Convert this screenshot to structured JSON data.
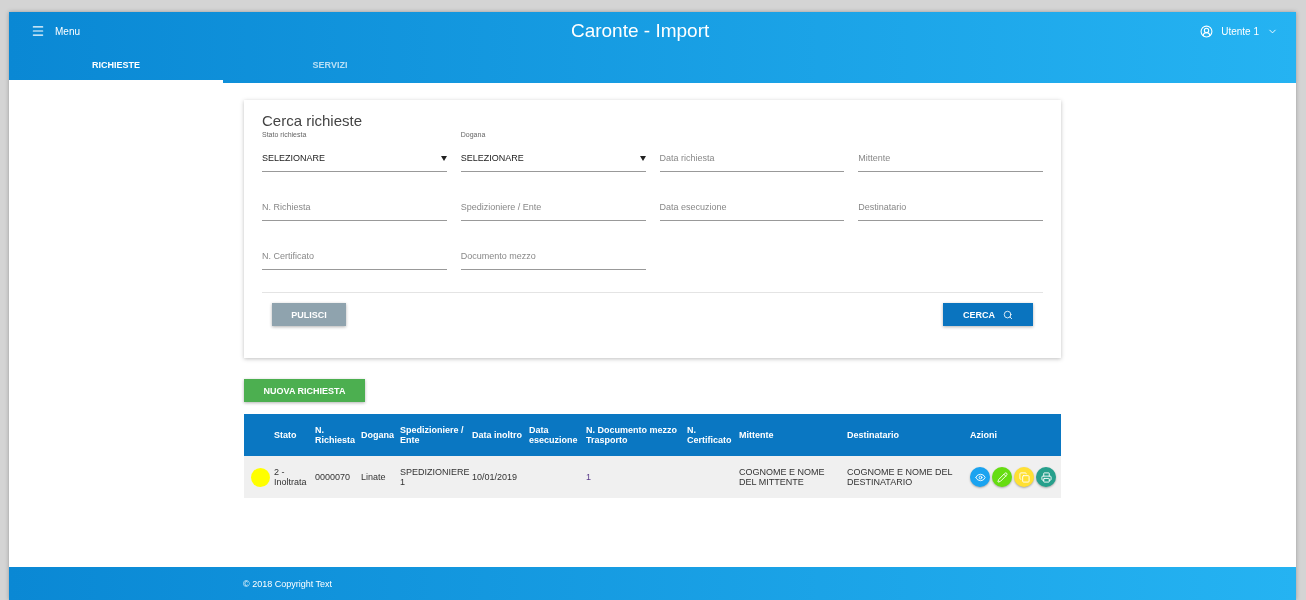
{
  "header": {
    "menu_label": "Menu",
    "title": "Caronte - Import",
    "user": "Utente 1"
  },
  "tabs": [
    {
      "label": "RICHIESTE",
      "selected": true
    },
    {
      "label": "SERVIZI",
      "selected": false
    }
  ],
  "search_card": {
    "title": "Cerca richieste",
    "fields": [
      {
        "kind": "select",
        "label": "Stato richiesta",
        "value": "SELEZIONARE"
      },
      {
        "kind": "select",
        "label": "Dogana",
        "value": "SELEZIONARE"
      },
      {
        "kind": "text",
        "placeholder": "Data richiesta"
      },
      {
        "kind": "text",
        "placeholder": "Mittente"
      },
      {
        "kind": "text",
        "placeholder": "N. Richiesta"
      },
      {
        "kind": "text",
        "placeholder": "Spedizioniere / Ente"
      },
      {
        "kind": "text",
        "placeholder": "Data esecuzione"
      },
      {
        "kind": "text",
        "placeholder": "Destinatario"
      },
      {
        "kind": "text",
        "placeholder": "N. Certificato"
      },
      {
        "kind": "text",
        "placeholder": "Documento mezzo"
      }
    ],
    "clear_button": "PULISCI",
    "search_button": "CERCA"
  },
  "new_button": "NUOVA RICHIESTA",
  "table": {
    "columns": [
      "Stato",
      "N. Richiesta",
      "Dogana",
      "Spedizioniere / Ente",
      "Data inoltro",
      "Data esecuzione",
      "N. Documento mezzo Trasporto",
      "N. Certificato",
      "Mittente",
      "Destinatario",
      "Azioni"
    ],
    "rows": [
      {
        "color": "#ffff00",
        "cells": [
          "2 - Inoltrata",
          "0000070",
          "Linate",
          "SPEDIZIONIERE 1",
          "10/01/2019",
          "",
          "1",
          "",
          "COGNOME E NOME DEL MITTENTE",
          "COGNOME E NOME DEL DESTINATARIO"
        ],
        "actions": [
          {
            "kind": "view"
          },
          {
            "kind": "edit"
          },
          {
            "kind": "copy"
          },
          {
            "kind": "print"
          }
        ]
      }
    ]
  },
  "footer": "© 2018 Copyright Text"
}
